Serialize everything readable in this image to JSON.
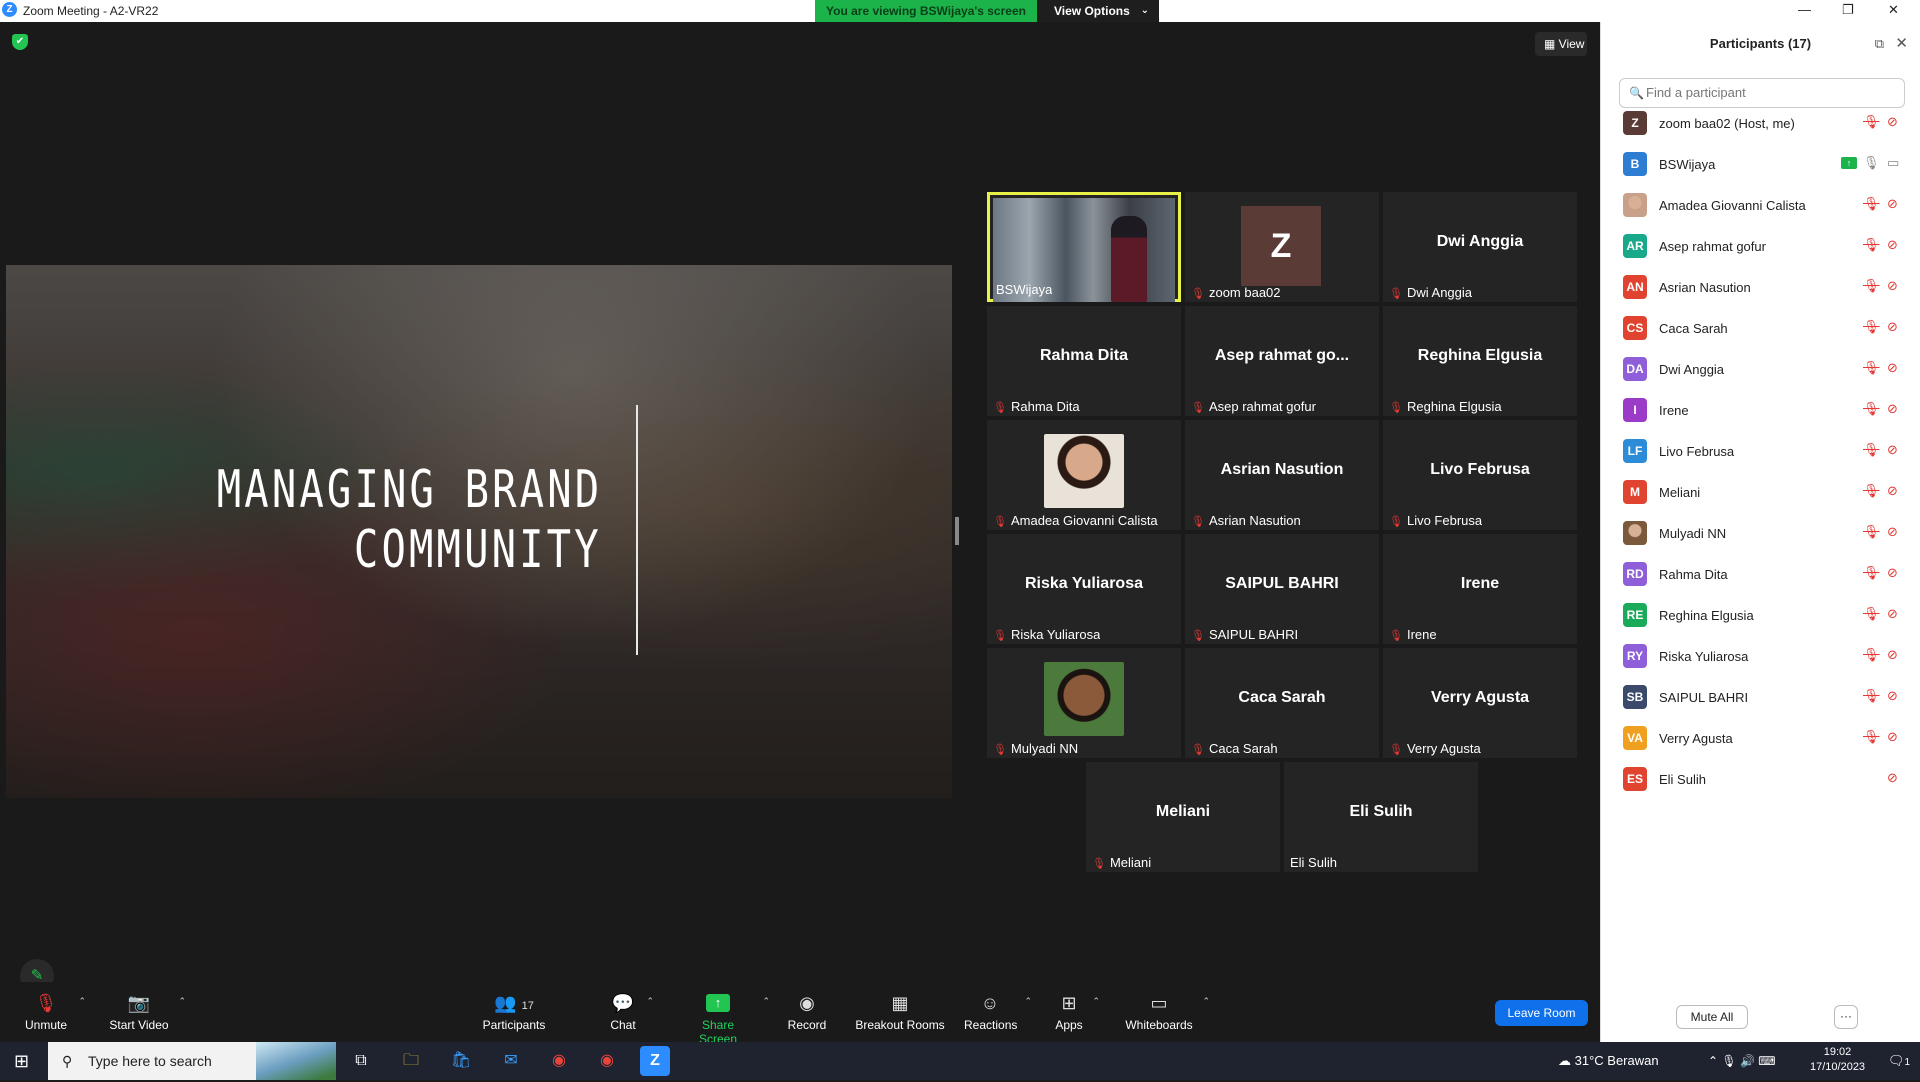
{
  "window": {
    "title": "Zoom Meeting - A2-VR22",
    "logo": "Z"
  },
  "banner": {
    "viewing_text": "You are viewing BSWijaya's screen",
    "view_options": "View Options"
  },
  "view_button": "View",
  "slide": {
    "line1": "MANAGING BRAND",
    "line2": "COMMUNITY"
  },
  "tiles": [
    {
      "type": "video",
      "name": "BSWijaya",
      "muted": false
    },
    {
      "type": "avatar",
      "initial": "Z",
      "name": "zoom baa02",
      "muted": true
    },
    {
      "type": "name",
      "display": "Dwi Anggia",
      "name": "Dwi Anggia",
      "muted": true
    },
    {
      "type": "name",
      "display": "Rahma Dita",
      "name": "Rahma Dita",
      "muted": true
    },
    {
      "type": "name",
      "display": "Asep rahmat go...",
      "name": "Asep rahmat gofur",
      "muted": true
    },
    {
      "type": "name",
      "display": "Reghina Elgusia",
      "name": "Reghina Elgusia",
      "muted": true
    },
    {
      "type": "photo",
      "name": "Amadea Giovanni Calista",
      "muted": true
    },
    {
      "type": "name",
      "display": "Asrian Nasution",
      "name": "Asrian Nasution",
      "muted": true
    },
    {
      "type": "name",
      "display": "Livo Februsa",
      "name": "Livo Februsa",
      "muted": true
    },
    {
      "type": "name",
      "display": "Riska Yuliarosa",
      "name": "Riska Yuliarosa",
      "muted": true
    },
    {
      "type": "name",
      "display": "SAIPUL BAHRI",
      "name": "SAIPUL BAHRI",
      "muted": true
    },
    {
      "type": "name",
      "display": "Irene",
      "name": "Irene",
      "muted": true
    },
    {
      "type": "photo",
      "name": "Mulyadi NN",
      "muted": true
    },
    {
      "type": "name",
      "display": "Caca Sarah",
      "name": "Caca Sarah",
      "muted": true
    },
    {
      "type": "name",
      "display": "Verry Agusta",
      "name": "Verry Agusta",
      "muted": true
    },
    {
      "type": "name",
      "display": "Meliani",
      "name": "Meliani",
      "muted": true
    },
    {
      "type": "name",
      "display": "Eli Sulih",
      "name": "Eli Sulih",
      "muted": false
    }
  ],
  "toolbar": {
    "unmute": "Unmute",
    "start_video": "Start Video",
    "participants": "Participants",
    "participants_count": "17",
    "chat": "Chat",
    "share_screen": "Share Screen",
    "record": "Record",
    "breakout": "Breakout Rooms",
    "reactions": "Reactions",
    "apps": "Apps",
    "whiteboards": "Whiteboards",
    "leave": "Leave Room"
  },
  "panel": {
    "title": "Participants (17)",
    "search_placeholder": "Find a participant",
    "mute_all": "Mute All",
    "more": "···",
    "participants": [
      {
        "initials": "Z",
        "name": "zoom baa02 (Host, me)",
        "color": "#5b3b35",
        "mic": "off",
        "cam": "off"
      },
      {
        "initials": "B",
        "name": "BSWijaya",
        "color": "#2d7dd2",
        "mic": "on",
        "cam": "on",
        "sharing": true
      },
      {
        "initials": "",
        "name": "Amadea Giovanni Calista",
        "color": "#c9a18a",
        "mic": "off",
        "cam": "off",
        "photo": true
      },
      {
        "initials": "AR",
        "name": "Asep rahmat gofur",
        "color": "#1aa88a",
        "mic": "off",
        "cam": "off"
      },
      {
        "initials": "AN",
        "name": "Asrian Nasution",
        "color": "#e0432f",
        "mic": "off",
        "cam": "off"
      },
      {
        "initials": "CS",
        "name": "Caca Sarah",
        "color": "#e0432f",
        "mic": "off",
        "cam": "off"
      },
      {
        "initials": "DA",
        "name": "Dwi Anggia",
        "color": "#8e5fd8",
        "mic": "off",
        "cam": "off"
      },
      {
        "initials": "I",
        "name": "Irene",
        "color": "#9a3cc8",
        "mic": "off",
        "cam": "off"
      },
      {
        "initials": "LF",
        "name": "Livo Februsa",
        "color": "#2d8cd8",
        "mic": "off",
        "cam": "off"
      },
      {
        "initials": "M",
        "name": "Meliani",
        "color": "#e0432f",
        "mic": "off",
        "cam": "off"
      },
      {
        "initials": "",
        "name": "Mulyadi NN",
        "color": "#7a5a3a",
        "mic": "off",
        "cam": "off",
        "photo": true
      },
      {
        "initials": "RD",
        "name": "Rahma Dita",
        "color": "#8e5fd8",
        "mic": "off",
        "cam": "off"
      },
      {
        "initials": "RE",
        "name": "Reghina Elgusia",
        "color": "#1aaa5a",
        "mic": "off",
        "cam": "off"
      },
      {
        "initials": "RY",
        "name": "Riska Yuliarosa",
        "color": "#8e5fd8",
        "mic": "off",
        "cam": "off"
      },
      {
        "initials": "SB",
        "name": "SAIPUL BAHRI",
        "color": "#3b4a6b",
        "mic": "off",
        "cam": "off"
      },
      {
        "initials": "VA",
        "name": "Verry Agusta",
        "color": "#f0a020",
        "mic": "off",
        "cam": "off"
      },
      {
        "initials": "ES",
        "name": "Eli Sulih",
        "color": "#e0432f",
        "mic": "none",
        "cam": "off"
      }
    ]
  },
  "taskbar": {
    "search_placeholder": "Type here to search",
    "weather": "31°C Berawan",
    "time": "19:02",
    "date": "17/10/2023",
    "notifications": "1"
  }
}
